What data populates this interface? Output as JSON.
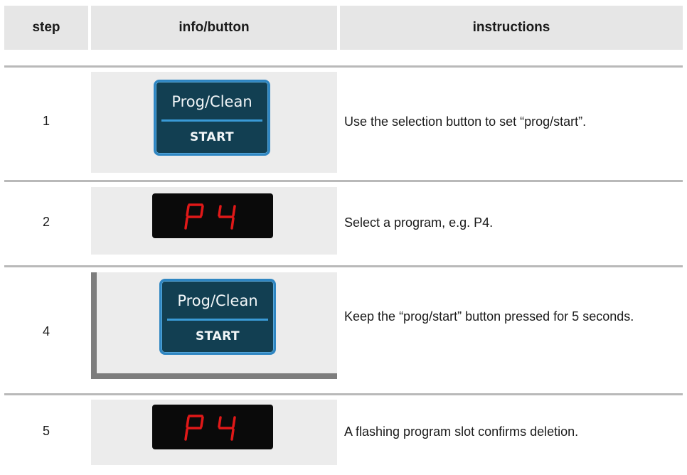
{
  "header": {
    "step": "step",
    "info": "info/button",
    "instructions": "instructions"
  },
  "rows": [
    {
      "step": "1",
      "widget": "button",
      "button_top": "Prog/Clean",
      "button_bottom": "START",
      "instruction": "Use the selection button to set “prog/start”."
    },
    {
      "step": "2",
      "widget": "display",
      "display_text": "P4",
      "instruction": "Select a program, e.g. P4."
    },
    {
      "step": "4",
      "widget": "button",
      "button_top": "Prog/Clean",
      "button_bottom": "START",
      "instruction": "Keep the “prog/start” button pressed for 5 seconds."
    },
    {
      "step": "5",
      "widget": "display",
      "display_text": "P4",
      "instruction": "A flashing program slot confirms deletion."
    }
  ],
  "colors": {
    "button_bg": "#123f52",
    "button_border": "#2f86c2",
    "display_bg": "#0a0a0a",
    "display_segment": "#e01818",
    "header_bg": "#e6e6e6"
  },
  "icons": {
    "button": "prog-clean-start-button-icon",
    "display": "p4-led-display-icon"
  }
}
